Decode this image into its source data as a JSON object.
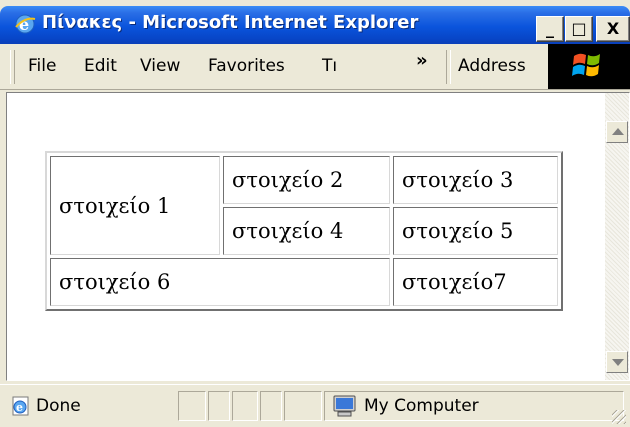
{
  "window": {
    "title": "Πίνακες - Microsoft Internet Explorer",
    "controls": {
      "minimize": "_",
      "maximize": "□",
      "close": "X"
    }
  },
  "menubar": {
    "items": [
      {
        "label": "File"
      },
      {
        "label": "Edit"
      },
      {
        "label": "View"
      },
      {
        "label": "Favorites"
      },
      {
        "label": "Tı"
      }
    ],
    "overflow": "»",
    "address_label": "Address"
  },
  "page": {
    "table": {
      "rows": [
        [
          "στοιχείο 1",
          "στοιχείο 2",
          "στοιχείο 3"
        ],
        [
          "στοιχείο 4",
          "στοιχείο 5"
        ],
        [
          "στοιχείο 6",
          "στοιχείο7"
        ]
      ]
    }
  },
  "statusbar": {
    "status_text": "Done",
    "zone_text": "My Computer"
  },
  "colors": {
    "titlebar": "#0a54dc",
    "chrome": "#ece9d8"
  }
}
